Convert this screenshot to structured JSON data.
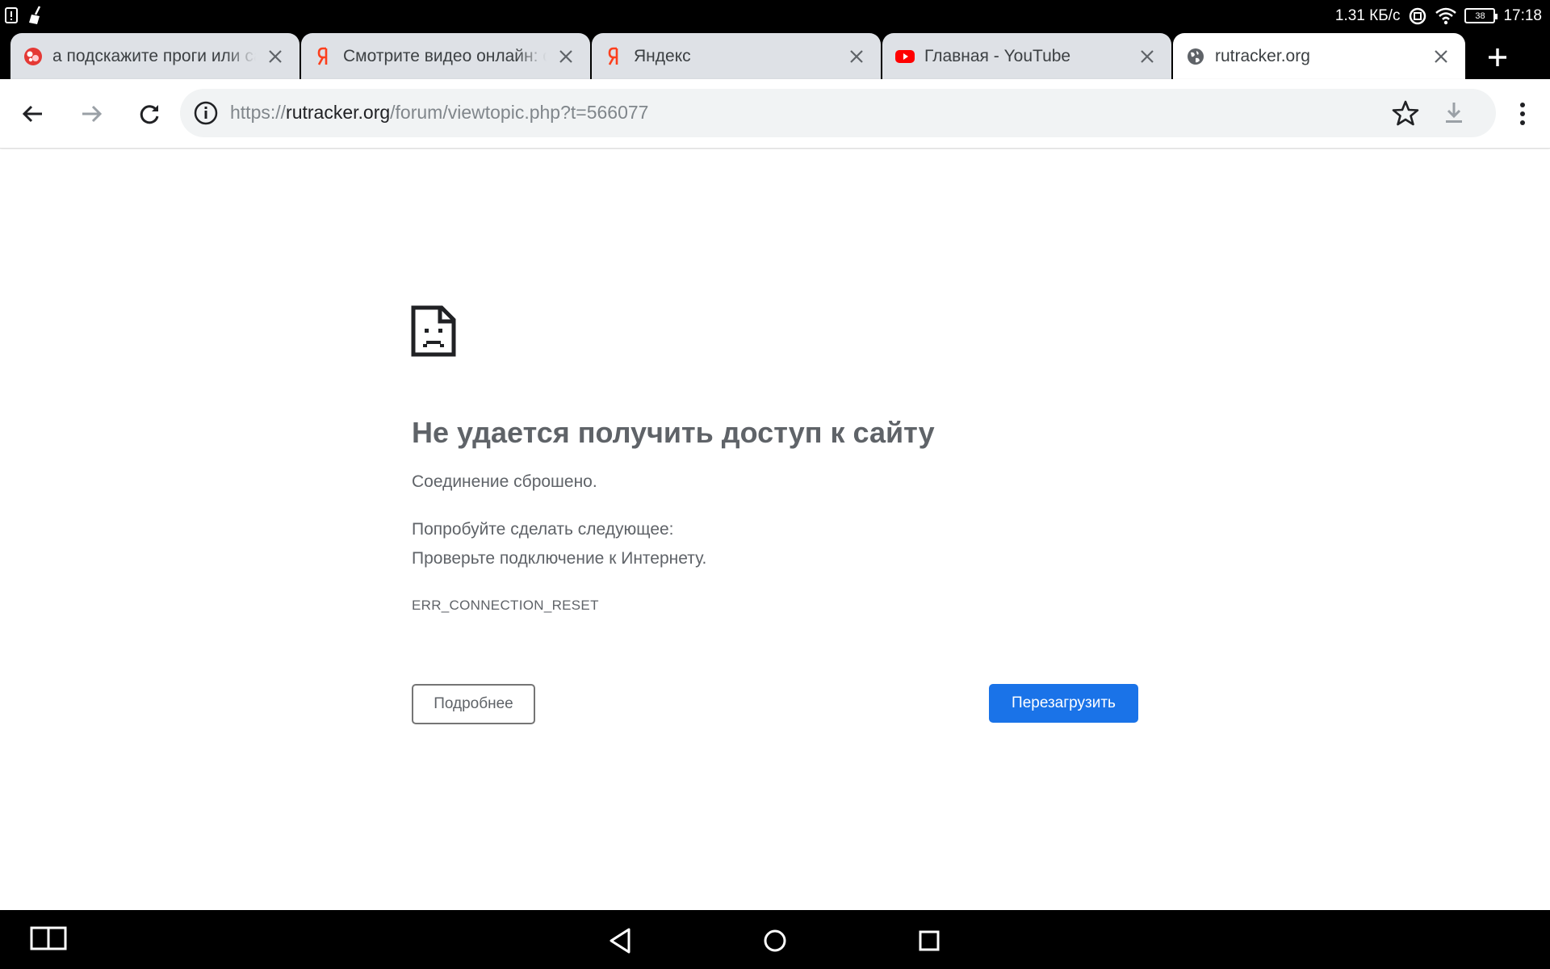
{
  "status_bar": {
    "net_speed": "1.31 КБ/с",
    "battery": "38",
    "time": "17:18"
  },
  "tabs": [
    {
      "title": "а подскажите проги или сайты",
      "favicon": "bubble-icon",
      "active": false
    },
    {
      "title": "Смотрите видео онлайн: сериалы",
      "favicon": "yandex-icon",
      "active": false
    },
    {
      "title": "Яндекс",
      "favicon": "yandex-icon",
      "active": false
    },
    {
      "title": "Главная - YouTube",
      "favicon": "youtube-icon",
      "active": false
    },
    {
      "title": "rutracker.org",
      "favicon": "globe-icon",
      "active": true
    }
  ],
  "omnibox": {
    "scheme": "https://",
    "host": "rutracker.org",
    "path": "/forum/viewtopic.php?t=566077"
  },
  "error": {
    "title": "Не удается получить доступ к сайту",
    "subtitle": "Соединение сброшено.",
    "suggestion_header": "Попробуйте сделать следующее:",
    "suggestion_1": "Проверьте подключение к Интернету.",
    "code": "ERR_CONNECTION_RESET",
    "details_button": "Подробнее",
    "reload_button": "Перезагрузить"
  },
  "colors": {
    "accent": "#1a73e8",
    "text_secondary": "#5f6368",
    "tab_inactive": "#dee1e6",
    "youtube_red": "#ff0000",
    "yandex_red": "#fc3f1d"
  }
}
